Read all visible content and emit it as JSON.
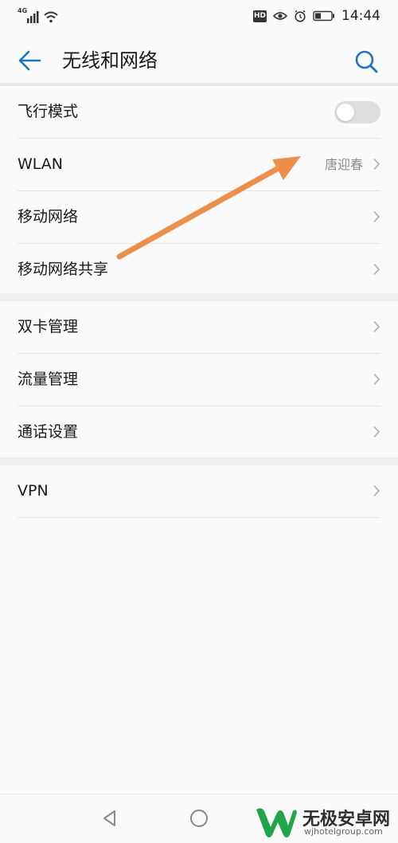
{
  "status_bar": {
    "network_label": "4G",
    "hd_label": "HD",
    "time": "14:44"
  },
  "header": {
    "title": "无线和网络",
    "back_icon": "arrow-left-icon",
    "search_icon": "search-icon"
  },
  "groups": [
    {
      "items": [
        {
          "label": "飞行模式",
          "type": "toggle",
          "on": false
        },
        {
          "label": "WLAN",
          "value": "唐迎春",
          "type": "link"
        },
        {
          "label": "移动网络",
          "type": "link"
        },
        {
          "label": "移动网络共享",
          "type": "link"
        }
      ]
    },
    {
      "items": [
        {
          "label": "双卡管理",
          "type": "link"
        },
        {
          "label": "流量管理",
          "type": "link"
        },
        {
          "label": "通话设置",
          "type": "link"
        }
      ]
    },
    {
      "items": [
        {
          "label": "VPN",
          "type": "link"
        }
      ]
    }
  ],
  "annotation": {
    "color": "#ee8f49",
    "icon": "arrow-annotation"
  },
  "colors": {
    "accent": "#1a73c9",
    "background": "#fafafa",
    "divider": "#efefef"
  },
  "watermark": {
    "title": "无极安卓网",
    "url": "wjhotelgroup.com",
    "logo_color": "#1fa64a"
  }
}
